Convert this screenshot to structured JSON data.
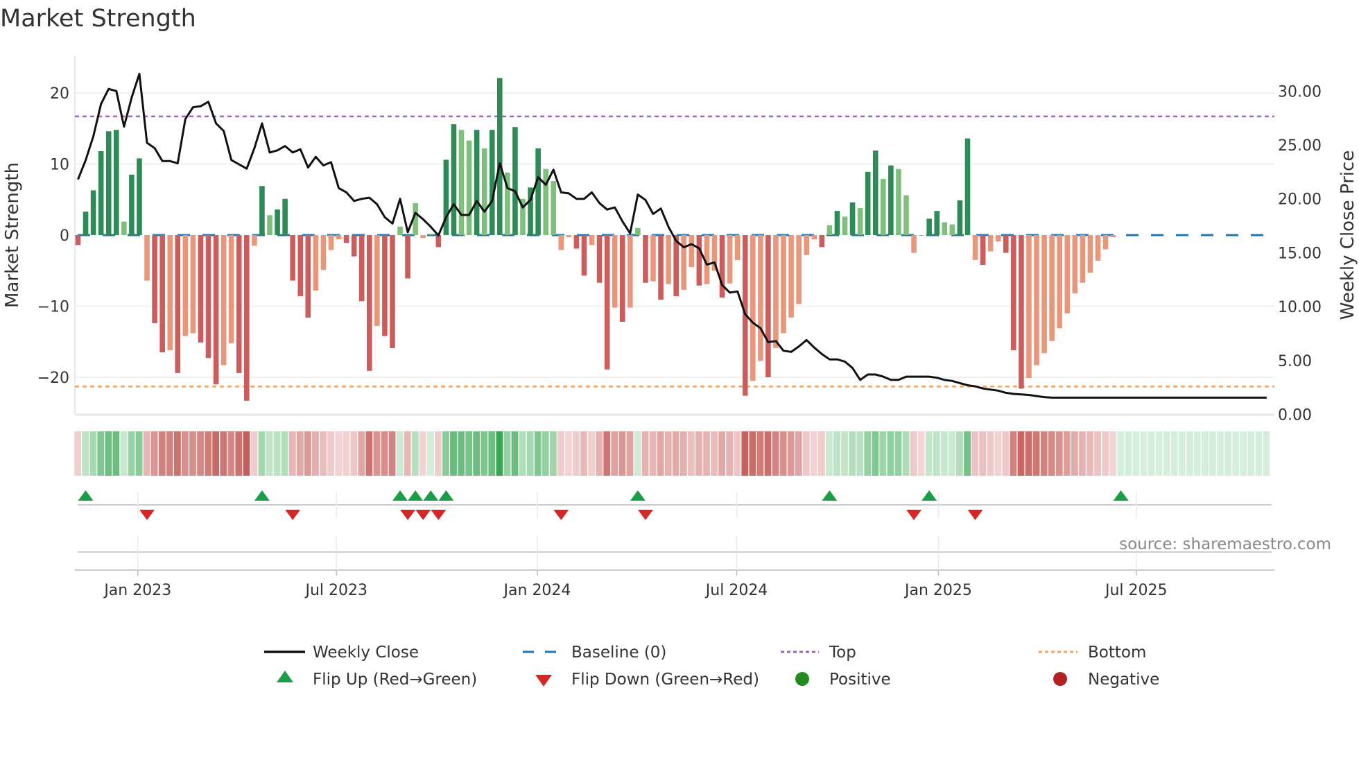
{
  "title": "Market Strength",
  "source": "source: sharemaestro.com",
  "colors": {
    "pos_strong": "#2e8b57",
    "pos_weak": "#7fbf7b",
    "neg_strong": "#cd5c5c",
    "neg_weak": "#e9967a",
    "baseline": "#1f77b4",
    "top": "#9467bd",
    "bottom": "#f4a460",
    "flip_up": "#1a9e47",
    "flip_down": "#d62728",
    "positive": "#228b22",
    "negative": "#b22222"
  },
  "chart_data": {
    "type": "bar",
    "title": "Market Strength",
    "ylabel": "Market Strength",
    "y2label": "Weekly Close Price",
    "ylim": [
      -25,
      25
    ],
    "y2lim": [
      0,
      33
    ],
    "yticks": [
      "20",
      "10",
      "0",
      "−10",
      "−20"
    ],
    "ytick_values": [
      20,
      10,
      0,
      -10,
      -20
    ],
    "y2ticks": [
      "30.00",
      "25.00",
      "20.00",
      "15.00",
      "10.00",
      "5.00",
      "0.00"
    ],
    "y2tick_values": [
      30,
      25,
      20,
      15,
      10,
      5,
      0
    ],
    "xticks": [
      "Jan 2023",
      "Jul 2023",
      "Jan 2024",
      "Jul 2024",
      "Jan 2025",
      "Jul 2025"
    ],
    "xtick_weeks": [
      7.8,
      33.7,
      59.9,
      85.9,
      112.2,
      138.0
    ],
    "week_count": 156,
    "top_level": 16.7,
    "bottom_level": -21.3,
    "baseline": 0,
    "strength": [
      -1.4,
      3.3,
      6.3,
      11.8,
      14.6,
      14.8,
      1.9,
      8.5,
      10.8,
      -6.4,
      -12.4,
      -16.5,
      -16.2,
      -19.4,
      -14.2,
      -13.8,
      -15.1,
      -17.3,
      -21.0,
      -18.3,
      -15.2,
      -19.4,
      -23.3,
      -1.5,
      6.9,
      2.8,
      3.6,
      5.1,
      -6.4,
      -8.6,
      -11.6,
      -7.8,
      -4.9,
      -2.1,
      -0.6,
      -1.1,
      -3.0,
      -9.3,
      -19.1,
      -12.8,
      -14.2,
      -15.9,
      1.2,
      -6.1,
      4.5,
      -0.4,
      0.2,
      -1.7,
      10.6,
      15.6,
      14.8,
      13.3,
      14.8,
      12.2,
      14.8,
      22.1,
      8.8,
      15.2,
      5.1,
      6.7,
      12.2,
      9.3,
      7.6,
      -2.1,
      -0.3,
      -1.9,
      -5.7,
      -1.4,
      -6.7,
      -18.9,
      -10.2,
      -12.2,
      -10.2,
      1.0,
      -6.7,
      -6.5,
      -9.1,
      -6.9,
      -8.6,
      -7.7,
      -4.5,
      -7.1,
      -6.9,
      -5.0,
      -8.8,
      -6.8,
      -3.5,
      -22.6,
      -20.5,
      -17.7,
      -20.0,
      -15.9,
      -13.8,
      -11.6,
      -9.7,
      -2.8,
      -0.6,
      -1.7,
      1.4,
      3.4,
      2.6,
      4.6,
      3.8,
      8.9,
      11.9,
      7.9,
      9.8,
      9.3,
      5.6,
      -2.5,
      -0.1,
      2.3,
      3.4,
      1.8,
      1.5,
      4.9,
      13.6,
      -3.5,
      -4.2,
      -2.3,
      -0.9,
      -2.5,
      -16.2,
      -21.6,
      -20.1,
      -18.3,
      -16.6,
      -14.9,
      -13.1,
      -11.0,
      -8.2,
      -6.7,
      -5.3,
      -3.6,
      -2.0,
      -0.3
    ],
    "weekly_close": [
      21.8,
      23.6,
      25.8,
      28.8,
      30.2,
      30.0,
      26.7,
      29.4,
      31.6,
      25.2,
      24.7,
      23.5,
      23.5,
      23.3,
      27.4,
      28.5,
      28.6,
      29.0,
      27.0,
      26.3,
      23.6,
      23.2,
      22.8,
      24.7,
      27.0,
      24.3,
      24.5,
      24.9,
      24.3,
      24.6,
      22.9,
      23.9,
      23.1,
      23.4,
      21.0,
      20.6,
      19.8,
      20.0,
      20.1,
      19.5,
      18.3,
      17.7,
      20.0,
      16.9,
      18.7,
      18.1,
      17.4,
      16.6,
      18.3,
      19.5,
      18.5,
      18.5,
      19.8,
      18.8,
      19.8,
      23.3,
      21.0,
      20.7,
      19.2,
      19.9,
      22.0,
      21.3,
      22.7,
      20.6,
      20.5,
      20.0,
      20.0,
      20.6,
      19.6,
      19.0,
      19.2,
      17.9,
      16.8,
      20.4,
      19.9,
      18.6,
      19.1,
      17.4,
      16.1,
      15.5,
      15.8,
      15.4,
      13.9,
      14.1,
      12.0,
      11.3,
      11.4,
      9.3,
      8.5,
      8.0,
      6.7,
      6.8,
      5.9,
      5.8,
      6.3,
      6.9,
      6.2,
      5.6,
      5.1,
      5.1,
      4.9,
      4.3,
      3.2,
      3.7,
      3.7,
      3.5,
      3.2,
      3.2,
      3.5,
      3.5,
      3.5,
      3.5,
      3.4,
      3.2,
      3.1,
      2.9,
      2.7,
      2.6,
      2.4,
      2.3,
      2.2,
      2.0,
      1.9,
      1.85,
      1.8,
      1.7,
      1.6,
      1.55,
      1.55,
      1.55,
      1.55,
      1.55,
      1.55,
      1.55,
      1.55,
      1.55,
      1.55,
      1.55,
      1.55,
      1.55,
      1.55,
      1.55,
      1.55,
      1.55,
      1.55,
      1.55,
      1.55,
      1.55,
      1.55,
      1.55,
      1.55,
      1.55,
      1.55,
      1.55,
      1.55,
      1.55
    ],
    "flip_up_weeks": [
      1,
      24,
      42,
      44,
      46,
      48,
      73,
      98,
      111,
      136
    ],
    "flip_down_weeks": [
      9,
      28,
      43,
      45,
      47,
      63,
      74,
      109,
      117
    ],
    "legend": {
      "weekly_close": "Weekly Close",
      "baseline": "Baseline (0)",
      "top": "Top",
      "bottom": "Bottom",
      "flip_up": "Flip Up (Red→Green)",
      "flip_down": "Flip Down (Green→Red)",
      "positive": "Positive",
      "negative": "Negative"
    },
    "legend_position": "bottom-center"
  }
}
